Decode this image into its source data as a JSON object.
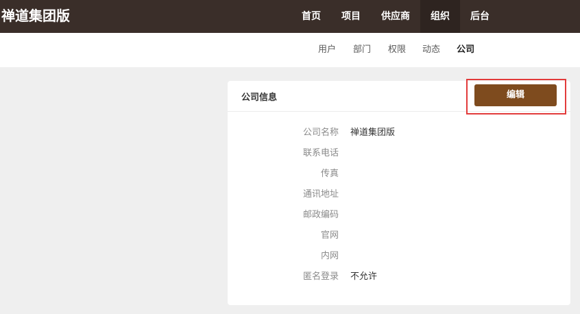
{
  "header": {
    "brand": "禅道集团版",
    "nav": [
      {
        "label": "首页"
      },
      {
        "label": "项目"
      },
      {
        "label": "供应商"
      },
      {
        "label": "组织",
        "active": true
      },
      {
        "label": "后台"
      }
    ]
  },
  "subnav": [
    {
      "label": "用户"
    },
    {
      "label": "部门"
    },
    {
      "label": "权限"
    },
    {
      "label": "动态"
    },
    {
      "label": "公司",
      "active": true
    }
  ],
  "panel": {
    "title": "公司信息",
    "edit_label": "编辑",
    "fields": [
      {
        "label": "公司名称",
        "value": "禅道集团版"
      },
      {
        "label": "联系电话",
        "value": ""
      },
      {
        "label": "传真",
        "value": ""
      },
      {
        "label": "通讯地址",
        "value": ""
      },
      {
        "label": "邮政编码",
        "value": ""
      },
      {
        "label": "官网",
        "value": ""
      },
      {
        "label": "内网",
        "value": ""
      },
      {
        "label": "匿名登录",
        "value": "不允许"
      }
    ]
  },
  "colors": {
    "header_bg": "#3a2e29",
    "accent": "#7e4b1e",
    "highlight": "#e23a3a"
  }
}
